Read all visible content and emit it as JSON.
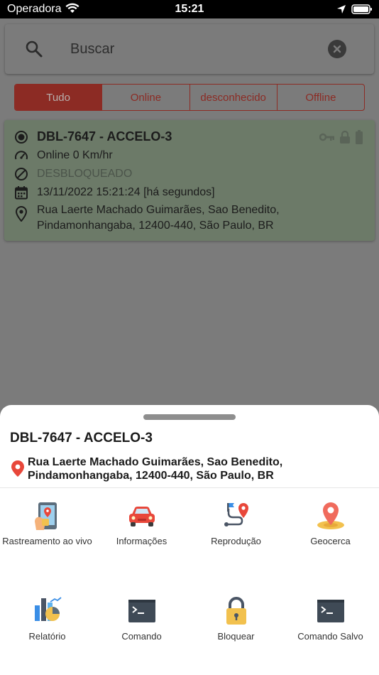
{
  "status_bar": {
    "carrier": "Operadora",
    "time": "15:21"
  },
  "search": {
    "placeholder": "Buscar"
  },
  "tabs": [
    {
      "label": "Tudo",
      "active": true
    },
    {
      "label": "Online",
      "active": false
    },
    {
      "label": "desconhecido",
      "active": false
    },
    {
      "label": "Offline",
      "active": false
    }
  ],
  "device": {
    "name": "DBL-7647 - ACCELO-3",
    "speed": "Online 0 Km/hr",
    "lock_status": "DESBLOQUEADO",
    "timestamp": "13/11/2022 15:21:24 [há segundos]",
    "address_line1": "Rua Laerte Machado Guimarães, Sao Benedito,",
    "address_line2": "Pindamonhangaba, 12400-440, São Paulo, BR",
    "status_icons": [
      "key-icon",
      "lock-icon",
      "battery-icon"
    ]
  },
  "sheet": {
    "title": "DBL-7647 - ACCELO-3",
    "address_line1": "Rua Laerte Machado Guimarães, Sao Benedito,",
    "address_line2": "Pindamonhangaba, 12400-440, São Paulo, BR",
    "actions": [
      {
        "label": "Rastreamento ao vivo",
        "icon": "live-tracking-icon"
      },
      {
        "label": "Informações",
        "icon": "car-icon"
      },
      {
        "label": "Reprodução",
        "icon": "route-playback-icon"
      },
      {
        "label": "Geocerca",
        "icon": "geofence-pin-icon"
      },
      {
        "label": "Relatório",
        "icon": "report-chart-icon"
      },
      {
        "label": "Comando",
        "icon": "terminal-icon"
      },
      {
        "label": "Bloquear",
        "icon": "padlock-icon"
      },
      {
        "label": "Comando Salvo",
        "icon": "saved-terminal-icon"
      }
    ]
  },
  "colors": {
    "accent": "#d23a2f",
    "card_online": "#c8e6c2",
    "sheet_bg": "#ffffff"
  }
}
